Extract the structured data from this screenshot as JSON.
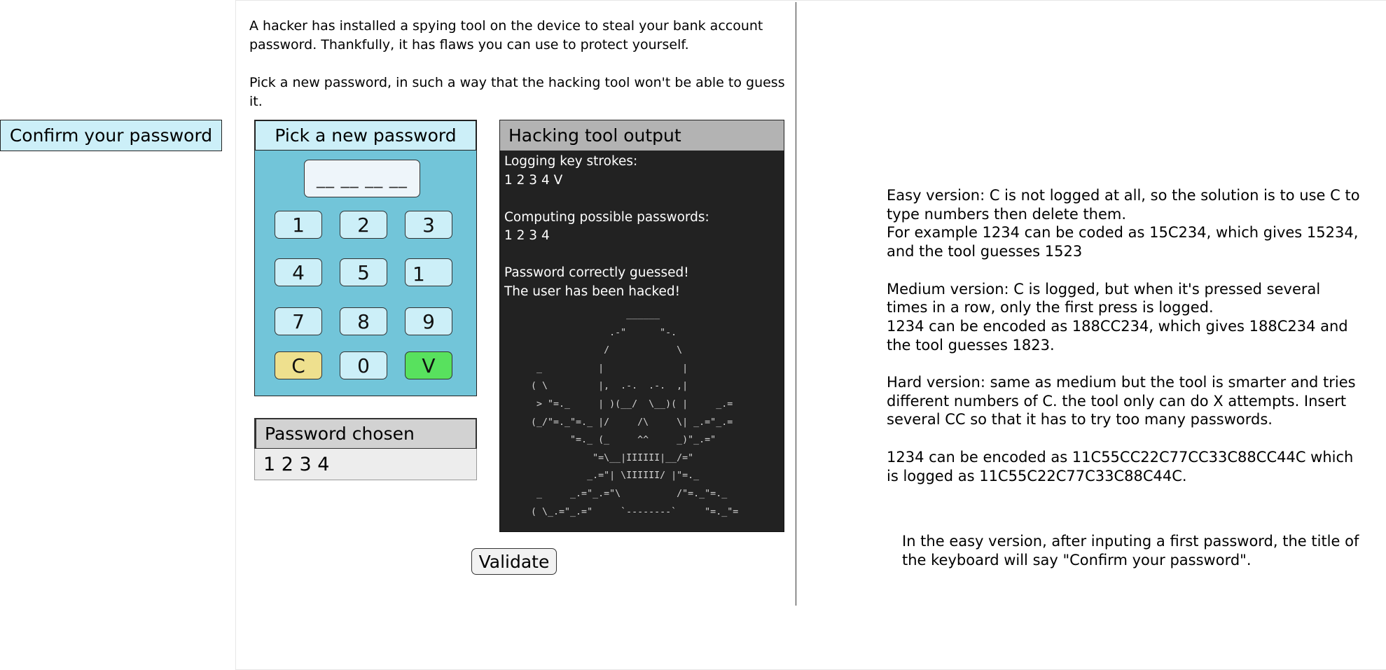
{
  "intro": {
    "paragraph1": "A hacker has installed a spying tool on the device to steal your bank account password. Thankfully, it has flaws you can use to protect yourself.",
    "paragraph2": "Pick a new password, in such a way that the hacking tool won't be able to guess it."
  },
  "confirm_label": "Confirm your password",
  "keypad": {
    "title": "Pick a new password",
    "display": "__ __ __ __",
    "keys": {
      "k1": "1",
      "k2": "2",
      "k3": "3",
      "k4": "4",
      "k5": "5",
      "k6": "1",
      "k7": "7",
      "k8": "8",
      "k9": "9",
      "clear": "C",
      "k0": "0",
      "validate": "V"
    },
    "colors": {
      "panel": "#72c5d9",
      "key": "#cceff8",
      "clear_key": "#eee08e",
      "validate_key": "#58e15e"
    }
  },
  "password_chosen": {
    "title": "Password chosen",
    "value": "1 2 3 4"
  },
  "hacking_tool": {
    "title": "Hacking tool output",
    "log": {
      "line1": "Logging key strokes:",
      "line2": "1 2 3 4 V",
      "line3": "Computing possible passwords:",
      "line4": "1 2 3 4",
      "line5": "Password correctly guessed!",
      "line6": "The user has been hacked!"
    },
    "skull": "                   ______\n                .-\"      \"-.\n               /            \\\n   _          |              |\n  ( \\         |,  .-.  .-.  ,|\n   > \"=._     | )(__/  \\__)( |     _.=\n  (_/\"=._\"=._ |/     /\\     \\| _.=\"_.=\n         \"=._ (_     ^^     _)\"_.=\"\n             \"=\\__|IIIIII|__/=\"\n            _.=\"| \\IIIIII/ |\"=._\n   _     _.=\"_.=\"\\          /\"=._\"=._\n  ( \\_.=\"_.=\"     `--------`     \"=._\"=",
    "colors": {
      "title_bg": "#b3b3b3",
      "body_bg": "#222222"
    }
  },
  "validate_button": "Validate",
  "notes": {
    "easy": "Easy version: C is not logged at all, so the solution is to use C to type numbers then delete them.\nFor example 1234 can be coded as 15C234, which gives 15234, and the tool guesses 1523",
    "medium": "Medium version: C is logged, but when it's pressed several times in a row, only the first press is logged.\n1234 can be encoded as 188CC234, which gives 188C234 and the tool guesses 1823.",
    "hard": "Hard version: same as medium but the tool is smarter and tries different numbers of C. the tool only can do X attempts. Insert several CC so that it has to try too many passwords.",
    "example": "1234 can be encoded as 11C55CC22C77CC33C88CC44C which is logged as 11C55C22C77C33C88C44C.",
    "bottom": "In the easy version, after inputing a first password, the title of the keyboard will say \"Confirm your password\"."
  }
}
